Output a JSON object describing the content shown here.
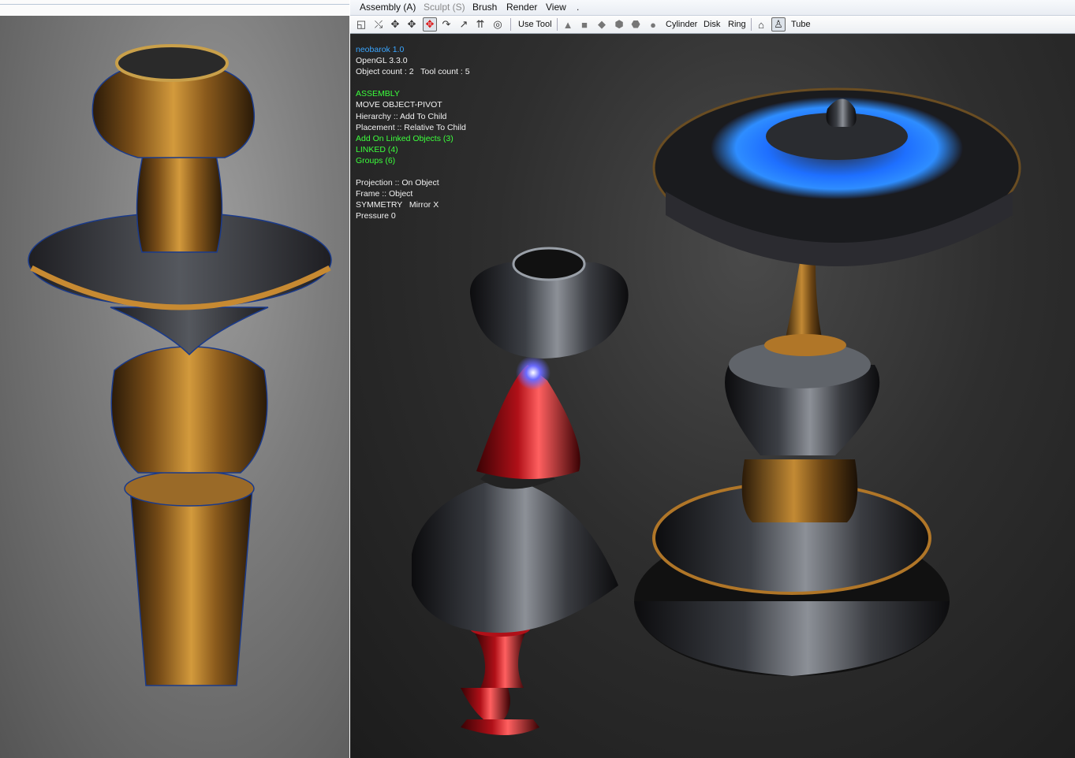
{
  "menu": {
    "items": [
      {
        "label": "Assembly (A)",
        "enabled": true
      },
      {
        "label": "Sculpt (S)",
        "enabled": false
      },
      {
        "label": "Brush",
        "enabled": true
      },
      {
        "label": "Render",
        "enabled": true
      },
      {
        "label": "View",
        "enabled": true
      },
      {
        "label": ".",
        "enabled": true
      }
    ]
  },
  "toolbar": {
    "icons": [
      "frame-icon",
      "rotate-tool-icon",
      "move-tool-icon",
      "translate-tool-icon",
      "pivot-tool-icon",
      "scale-tool-icon",
      "arrow-tool-icon",
      "align-up-icon",
      "target-icon"
    ],
    "use_tool_label": "Use Tool",
    "primitives": [
      "cone-icon",
      "cube-icon",
      "octahedron-icon",
      "dodecahedron-icon",
      "icosahedron-icon",
      "sphere-icon"
    ],
    "cylinder_label": "Cylinder",
    "disk_label": "Disk",
    "ring_label": "Ring",
    "tube_label": "Tube"
  },
  "hud": {
    "app_name": "neobarok 1.0",
    "opengl": "OpenGL 3.3.0",
    "counts": "Object count : 2   Tool count : 5",
    "mode": "ASSEMBLY",
    "action": "MOVE OBJECT-PIVOT",
    "hierarchy": "Hierarchy :: Add To Child",
    "placement": "Placement :: Relative To Child",
    "add_on_linked": "Add On Linked Objects (3)",
    "linked": "LINKED (4)",
    "groups": "Groups (6)",
    "projection": "Projection :: On Object",
    "frame": "Frame :: Object",
    "symmetry": "SYMMETRY   Mirror X",
    "pressure": "Pressure 0"
  },
  "colors": {
    "hud_accent_blue": "#3aa6ff",
    "hud_accent_green": "#3cff3c",
    "bronze": "#b07628",
    "glow_blue": "#1e7dff",
    "red": "#b01018"
  }
}
